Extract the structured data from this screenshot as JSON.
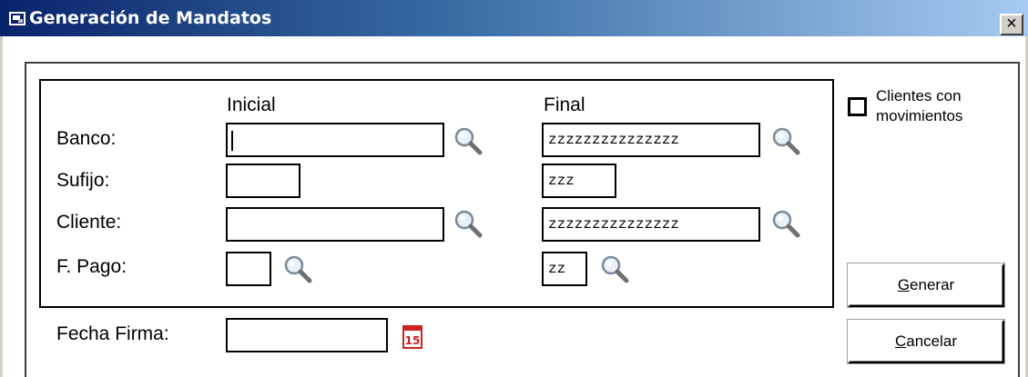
{
  "window": {
    "title": "Generación de Mandatos",
    "close_label": "×",
    "title_icon": "app-icon"
  },
  "criteria": {
    "col_initial_header": "Inicial",
    "col_final_header": "Final",
    "rows": [
      {
        "label": "Banco:",
        "initial": "",
        "final": "zzzzzzzzzzzzzzz"
      },
      {
        "label": "Sufijo:",
        "initial": "",
        "final": "zzz"
      },
      {
        "label": "Cliente:",
        "initial": "",
        "final": "zzzzzzzzzzzzzzz"
      },
      {
        "label": "F. Pago:",
        "initial": "",
        "final": "zz"
      }
    ],
    "search_icon": "search-icon"
  },
  "fecha_firma": {
    "label": "Fecha Firma:",
    "value": "",
    "calendar_icon": "calendar-icon",
    "calendar_text": "15"
  },
  "options": {
    "clientes_movimientos_label_line1": "Clientes con",
    "clientes_movimientos_label_line2": "movimientos",
    "clientes_movimientos_checked": false
  },
  "buttons": {
    "generar_first": "G",
    "generar_rest": "enerar",
    "cancelar_first": "C",
    "cancelar_rest": "ancelar"
  },
  "colors": {
    "titlebar_start": "#0a246a",
    "titlebar_end": "#a6caf0",
    "calendar_red": "#cc2222"
  }
}
